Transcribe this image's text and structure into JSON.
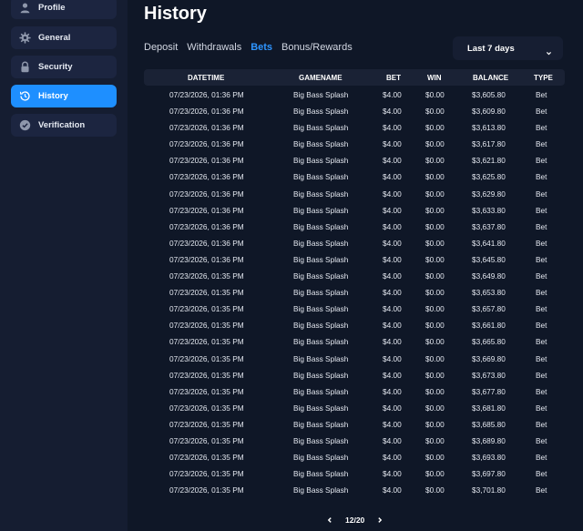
{
  "sidebar": {
    "items": [
      {
        "label": "Profile",
        "icon": "user-icon",
        "active": false
      },
      {
        "label": "General",
        "icon": "gear-icon",
        "active": false
      },
      {
        "label": "Security",
        "icon": "lock-icon",
        "active": false
      },
      {
        "label": "History",
        "icon": "history-icon",
        "active": true
      },
      {
        "label": "Verification",
        "icon": "verified-badge-icon",
        "active": false
      }
    ]
  },
  "main": {
    "title": "History",
    "tabs": [
      {
        "label": "Deposit",
        "active": false
      },
      {
        "label": "Withdrawals",
        "active": false
      },
      {
        "label": "Bets",
        "active": true
      },
      {
        "label": "Bonus/Rewards",
        "active": false
      }
    ],
    "period_select": {
      "value": "Last 7 days"
    },
    "table": {
      "columns": [
        "DATETIME",
        "GAMENAME",
        "BET",
        "WIN",
        "BALANCE",
        "TYPE"
      ],
      "rows": [
        [
          "07/23/2026, 01:36 PM",
          "Big Bass Splash",
          "$4.00",
          "$0.00",
          "$3,605.80",
          "Bet"
        ],
        [
          "07/23/2026, 01:36 PM",
          "Big Bass Splash",
          "$4.00",
          "$0.00",
          "$3,609.80",
          "Bet"
        ],
        [
          "07/23/2026, 01:36 PM",
          "Big Bass Splash",
          "$4.00",
          "$0.00",
          "$3,613.80",
          "Bet"
        ],
        [
          "07/23/2026, 01:36 PM",
          "Big Bass Splash",
          "$4.00",
          "$0.00",
          "$3,617.80",
          "Bet"
        ],
        [
          "07/23/2026, 01:36 PM",
          "Big Bass Splash",
          "$4.00",
          "$0.00",
          "$3,621.80",
          "Bet"
        ],
        [
          "07/23/2026, 01:36 PM",
          "Big Bass Splash",
          "$4.00",
          "$0.00",
          "$3,625.80",
          "Bet"
        ],
        [
          "07/23/2026, 01:36 PM",
          "Big Bass Splash",
          "$4.00",
          "$0.00",
          "$3,629.80",
          "Bet"
        ],
        [
          "07/23/2026, 01:36 PM",
          "Big Bass Splash",
          "$4.00",
          "$0.00",
          "$3,633.80",
          "Bet"
        ],
        [
          "07/23/2026, 01:36 PM",
          "Big Bass Splash",
          "$4.00",
          "$0.00",
          "$3,637.80",
          "Bet"
        ],
        [
          "07/23/2026, 01:36 PM",
          "Big Bass Splash",
          "$4.00",
          "$0.00",
          "$3,641.80",
          "Bet"
        ],
        [
          "07/23/2026, 01:36 PM",
          "Big Bass Splash",
          "$4.00",
          "$0.00",
          "$3,645.80",
          "Bet"
        ],
        [
          "07/23/2026, 01:35 PM",
          "Big Bass Splash",
          "$4.00",
          "$0.00",
          "$3,649.80",
          "Bet"
        ],
        [
          "07/23/2026, 01:35 PM",
          "Big Bass Splash",
          "$4.00",
          "$0.00",
          "$3,653.80",
          "Bet"
        ],
        [
          "07/23/2026, 01:35 PM",
          "Big Bass Splash",
          "$4.00",
          "$0.00",
          "$3,657.80",
          "Bet"
        ],
        [
          "07/23/2026, 01:35 PM",
          "Big Bass Splash",
          "$4.00",
          "$0.00",
          "$3,661.80",
          "Bet"
        ],
        [
          "07/23/2026, 01:35 PM",
          "Big Bass Splash",
          "$4.00",
          "$0.00",
          "$3,665.80",
          "Bet"
        ],
        [
          "07/23/2026, 01:35 PM",
          "Big Bass Splash",
          "$4.00",
          "$0.00",
          "$3,669.80",
          "Bet"
        ],
        [
          "07/23/2026, 01:35 PM",
          "Big Bass Splash",
          "$4.00",
          "$0.00",
          "$3,673.80",
          "Bet"
        ],
        [
          "07/23/2026, 01:35 PM",
          "Big Bass Splash",
          "$4.00",
          "$0.00",
          "$3,677.80",
          "Bet"
        ],
        [
          "07/23/2026, 01:35 PM",
          "Big Bass Splash",
          "$4.00",
          "$0.00",
          "$3,681.80",
          "Bet"
        ],
        [
          "07/23/2026, 01:35 PM",
          "Big Bass Splash",
          "$4.00",
          "$0.00",
          "$3,685.80",
          "Bet"
        ],
        [
          "07/23/2026, 01:35 PM",
          "Big Bass Splash",
          "$4.00",
          "$0.00",
          "$3,689.80",
          "Bet"
        ],
        [
          "07/23/2026, 01:35 PM",
          "Big Bass Splash",
          "$4.00",
          "$0.00",
          "$3,693.80",
          "Bet"
        ],
        [
          "07/23/2026, 01:35 PM",
          "Big Bass Splash",
          "$4.00",
          "$0.00",
          "$3,697.80",
          "Bet"
        ],
        [
          "07/23/2026, 01:35 PM",
          "Big Bass Splash",
          "$4.00",
          "$0.00",
          "$3,701.80",
          "Bet"
        ]
      ]
    },
    "pagination": {
      "current": "12/20"
    }
  },
  "colors": {
    "background": "#0f1727",
    "sidebar": "#151d31",
    "sidebar_item": "#1c2540",
    "accent": "#1e8fff",
    "active_tab": "#2e95ff",
    "table_header": "#1a2235"
  }
}
